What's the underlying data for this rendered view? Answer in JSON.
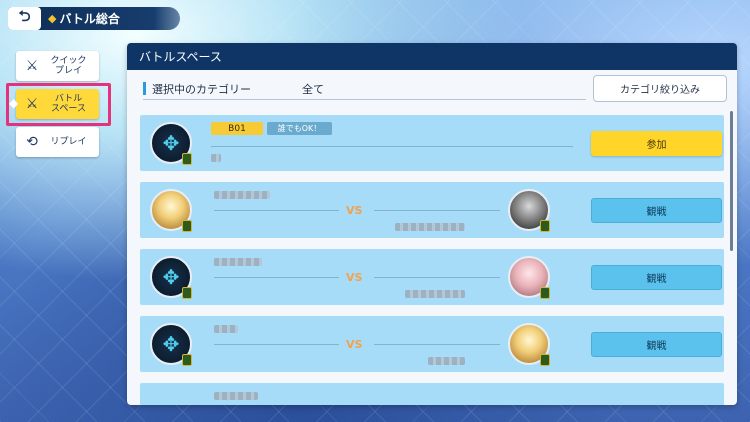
{
  "header": {
    "title": "バトル総合",
    "back_icon": "back-arrow-icon"
  },
  "sidebar": {
    "items": [
      {
        "label": "クイック\nプレイ",
        "icon": "crossed-swords-icon",
        "active": false
      },
      {
        "label": "バトル\nスペース",
        "icon": "battle-space-icon",
        "active": true
      },
      {
        "label": "リプレイ",
        "icon": "replay-icon",
        "active": false
      }
    ]
  },
  "panel": {
    "title": "バトルスペース",
    "filter_label": "選択中のカテゴリー",
    "filter_value": "全て",
    "filter_button": "カテゴリ絞り込み"
  },
  "rooms": [
    {
      "type": "open",
      "room_tag": "B01",
      "condition_tag": "誰でもOK！",
      "action": "参加"
    },
    {
      "type": "match",
      "vs": "VS",
      "action": "観戦"
    },
    {
      "type": "match",
      "vs": "VS",
      "action": "観戦"
    },
    {
      "type": "match",
      "vs": "VS",
      "action": "観戦"
    }
  ],
  "colors": {
    "header_bg": "#0f3567",
    "row_bg": "#a6dcf7",
    "join_button": "#ffd52a",
    "watch_button": "#5ac2ec",
    "vs_text": "#f0a24f",
    "active_highlight": "#e2337c"
  }
}
